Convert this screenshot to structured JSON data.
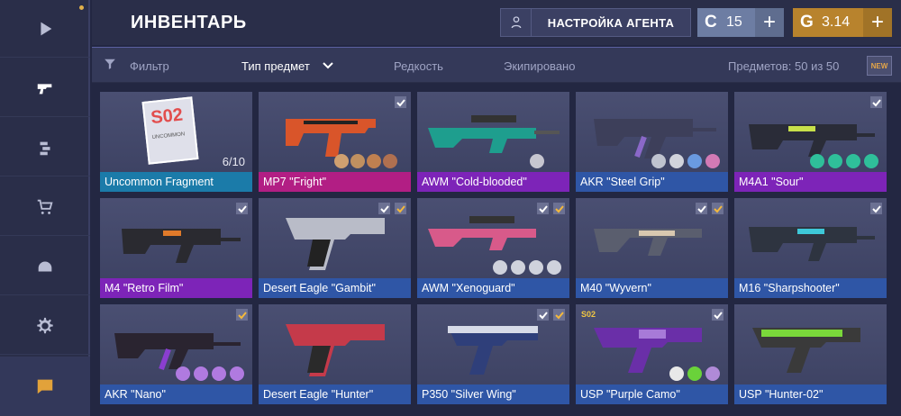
{
  "header": {
    "title": "ИНВЕНТАРЬ",
    "agent_label": "НАСТРОЙКА АГЕНТА",
    "silver_symbol": "C",
    "silver_value": "15",
    "gold_symbol": "G",
    "gold_value": "3.14",
    "plus": "+"
  },
  "filters": {
    "filter_label": "Фильтр",
    "type_label": "Тип предмет",
    "rarity_label": "Редкость",
    "equipped_label": "Экипировано",
    "count_label": "Предметов: 50 из 50",
    "new_badge": "NEW"
  },
  "sidebar": {
    "items": [
      "play",
      "weapons",
      "cases",
      "shop",
      "clan",
      "settings",
      "chat"
    ]
  },
  "items": [
    {
      "name": "Uncommon Fragment",
      "bar": "cyan",
      "fragment_code": "S02",
      "fragment_sub": "UNCOMMON",
      "count": "6/10"
    },
    {
      "name": "MP7 \"Fright\"",
      "bar": "pink"
    },
    {
      "name": "AWM \"Cold-blooded\"",
      "bar": "purple"
    },
    {
      "name": "AKR \"Steel Grip\"",
      "bar": "blue"
    },
    {
      "name": "M4A1 \"Sour\"",
      "bar": "purple"
    },
    {
      "name": "M4 \"Retro Film\"",
      "bar": "purple"
    },
    {
      "name": "Desert Eagle \"Gambit\"",
      "bar": "blue"
    },
    {
      "name": "AWM \"Xenoguard\"",
      "bar": "blue"
    },
    {
      "name": "M40 \"Wyvern\"",
      "bar": "blue"
    },
    {
      "name": "M16 \"Sharpshooter\"",
      "bar": "blue"
    },
    {
      "name": "AKR \"Nano\"",
      "bar": "blue"
    },
    {
      "name": "Desert Eagle \"Hunter\"",
      "bar": "blue"
    },
    {
      "name": "P350 \"Silver Wing\"",
      "bar": "blue"
    },
    {
      "name": "USP \"Purple Camo\"",
      "bar": "blue",
      "tag": "S02"
    },
    {
      "name": "USP \"Hunter-02\"",
      "bar": "blue"
    }
  ],
  "colors": {
    "accent_gold": "#b8832d",
    "accent_silver": "#6d7da3",
    "bar_blue": "#2f56a6",
    "bar_purple": "#7d24b8",
    "bar_pink": "#b21e84",
    "bar_cyan": "#1b7ba9"
  }
}
